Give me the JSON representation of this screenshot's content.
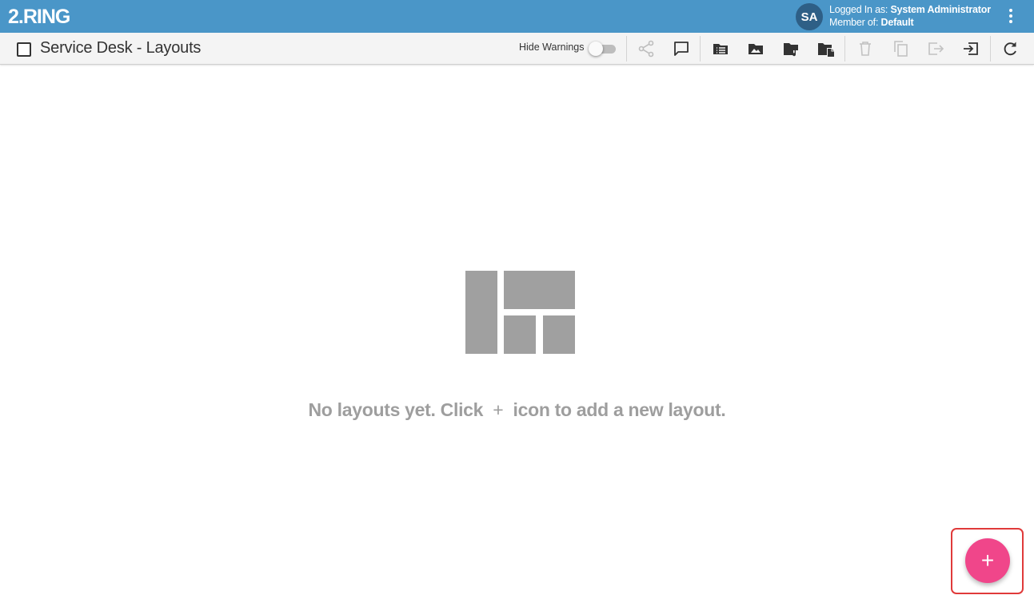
{
  "app": {
    "logo_text": "2.RING"
  },
  "user": {
    "initials": "SA",
    "logged_in_label": "Logged In as: ",
    "logged_in_name": "System Administrator",
    "member_label": "Member of: ",
    "member_name": "Default"
  },
  "toolbar": {
    "title": "Service Desk - Layouts",
    "hide_warnings_label": "Hide Warnings",
    "hide_warnings_on": false,
    "icons": [
      "share-icon",
      "comment-icon",
      "layout-list-icon",
      "image-icon",
      "audio-folder-icon",
      "copy-folder-icon",
      "delete-icon",
      "duplicate-icon",
      "export-icon",
      "import-icon",
      "refresh-icon"
    ]
  },
  "empty_state": {
    "text_before": "No layouts yet. Click",
    "plus_glyph": "+",
    "text_after": "icon to add a new layout."
  },
  "fab": {
    "label": "+"
  },
  "colors": {
    "appbar": "#4a96c8",
    "avatar": "#2e5f86",
    "fab": "#f0468a",
    "highlight": "#e03a3a",
    "muted": "#9e9e9e"
  }
}
